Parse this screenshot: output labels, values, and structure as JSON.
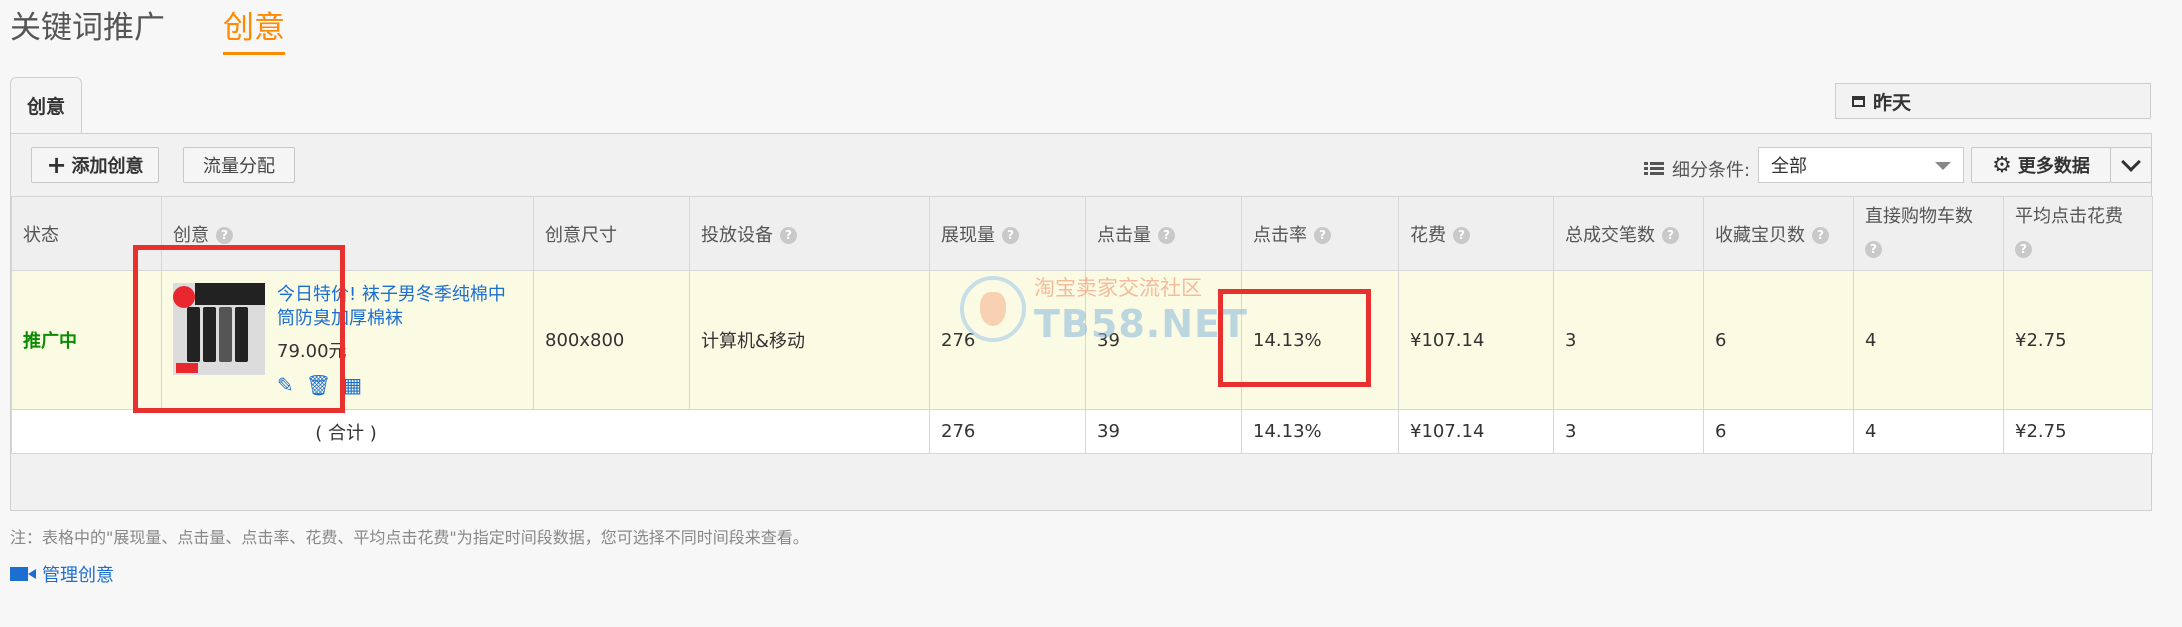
{
  "top_tabs": [
    {
      "label": "关键词推广",
      "active": false
    },
    {
      "label": "创意",
      "active": true
    }
  ],
  "panel_tab": "创意",
  "date_range": "昨天",
  "toolbar": {
    "add_label": "添加创意",
    "flow_label": "流量分配",
    "filter_label": "细分条件:",
    "filter_value": "全部",
    "more_label": "更多数据"
  },
  "table": {
    "headers": [
      "状态",
      "创意",
      "创意尺寸",
      "投放设备",
      "展现量",
      "点击量",
      "点击率",
      "花费",
      "总成交笔数",
      "收藏宝贝数",
      "直接购物车数",
      "平均点击花费"
    ],
    "row": {
      "status": "推广中",
      "title": "今日特价! 袜子男冬季纯棉中筒防臭加厚棉袜",
      "price": "79.00元",
      "size": "800x800",
      "device": "计算机&移动",
      "impressions": "276",
      "clicks": "39",
      "ctr": "14.13%",
      "cost": "¥107.14",
      "orders": "3",
      "favorites": "6",
      "cart": "4",
      "cpc": "¥2.75"
    },
    "total": {
      "label": "( 合计 )",
      "impressions": "276",
      "clicks": "39",
      "ctr": "14.13%",
      "cost": "¥107.14",
      "orders": "3",
      "favorites": "6",
      "cart": "4",
      "cpc": "¥2.75"
    }
  },
  "watermark": {
    "cn": "淘宝卖家交流社区",
    "en": "TB58.NET"
  },
  "note": "注：表格中的\"展现量、点击量、点击率、花费、平均点击花费\"为指定时间段数据，您可选择不同时间段来查看。",
  "manage_link": "管理创意",
  "colors": {
    "accent": "#ff8a00",
    "link": "#1c6fd1",
    "status_on": "#0a8c00",
    "highlight": "#e8312e"
  }
}
